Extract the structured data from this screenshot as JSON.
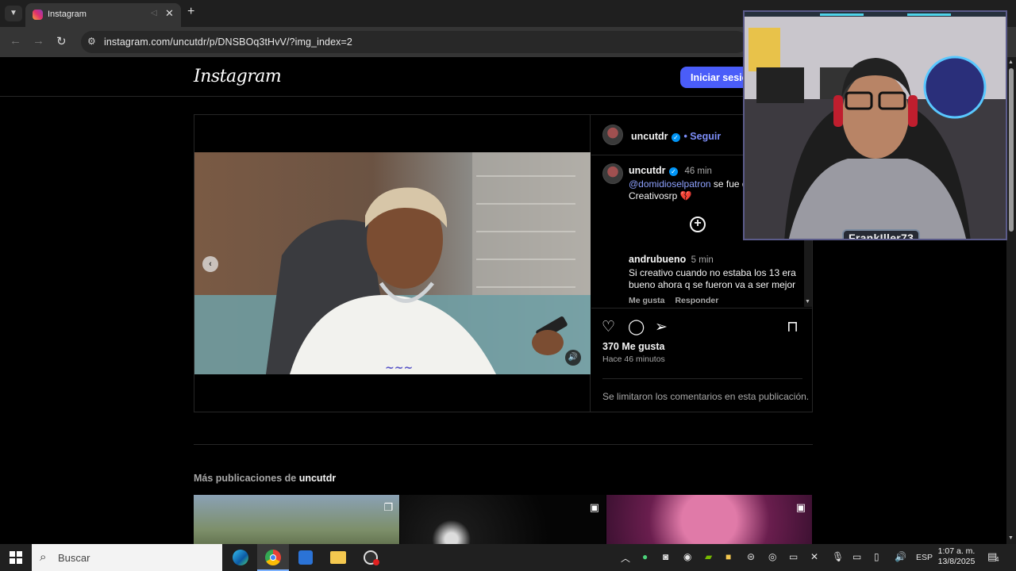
{
  "browser": {
    "tab_title": "Instagram",
    "url": "instagram.com/uncutdr/p/DNSBOq3tHvV/?img_index=2"
  },
  "header": {
    "logo": "Instagram",
    "login_button": "Iniciar sesión"
  },
  "post": {
    "author": "uncutdr",
    "follow_label": "• Seguir",
    "caption": {
      "username": "uncutdr",
      "time": "46 min",
      "mention": "@domidioselpatron",
      "text": " se fue d",
      "text2": "Creativosrp",
      "emoji": "💔"
    },
    "comment": {
      "username": "andrubueno",
      "time": "5 min",
      "text": "Si creativo cuando no estaba los 13 era bueno ahora q se fueron va a ser mejor",
      "like_label": "Me gusta",
      "reply_label": "Responder"
    },
    "likes": "370 Me gusta",
    "posted_ago": "Hace 46 minutos",
    "comments_limited": "Se limitaron los comentarios en esta publicación."
  },
  "more": {
    "prefix": "Más publicaciones de ",
    "username": "uncutdr"
  },
  "webcam": {
    "label": "FrankIller73"
  },
  "taskbar": {
    "search_placeholder": "Buscar",
    "language": "ESP",
    "time": "1:07 a. m.",
    "date": "13/8/2025",
    "notification_count": "4"
  },
  "colors": {
    "accent": "#4a5df9",
    "link": "#8ea2ff",
    "verified": "#0095f6"
  }
}
